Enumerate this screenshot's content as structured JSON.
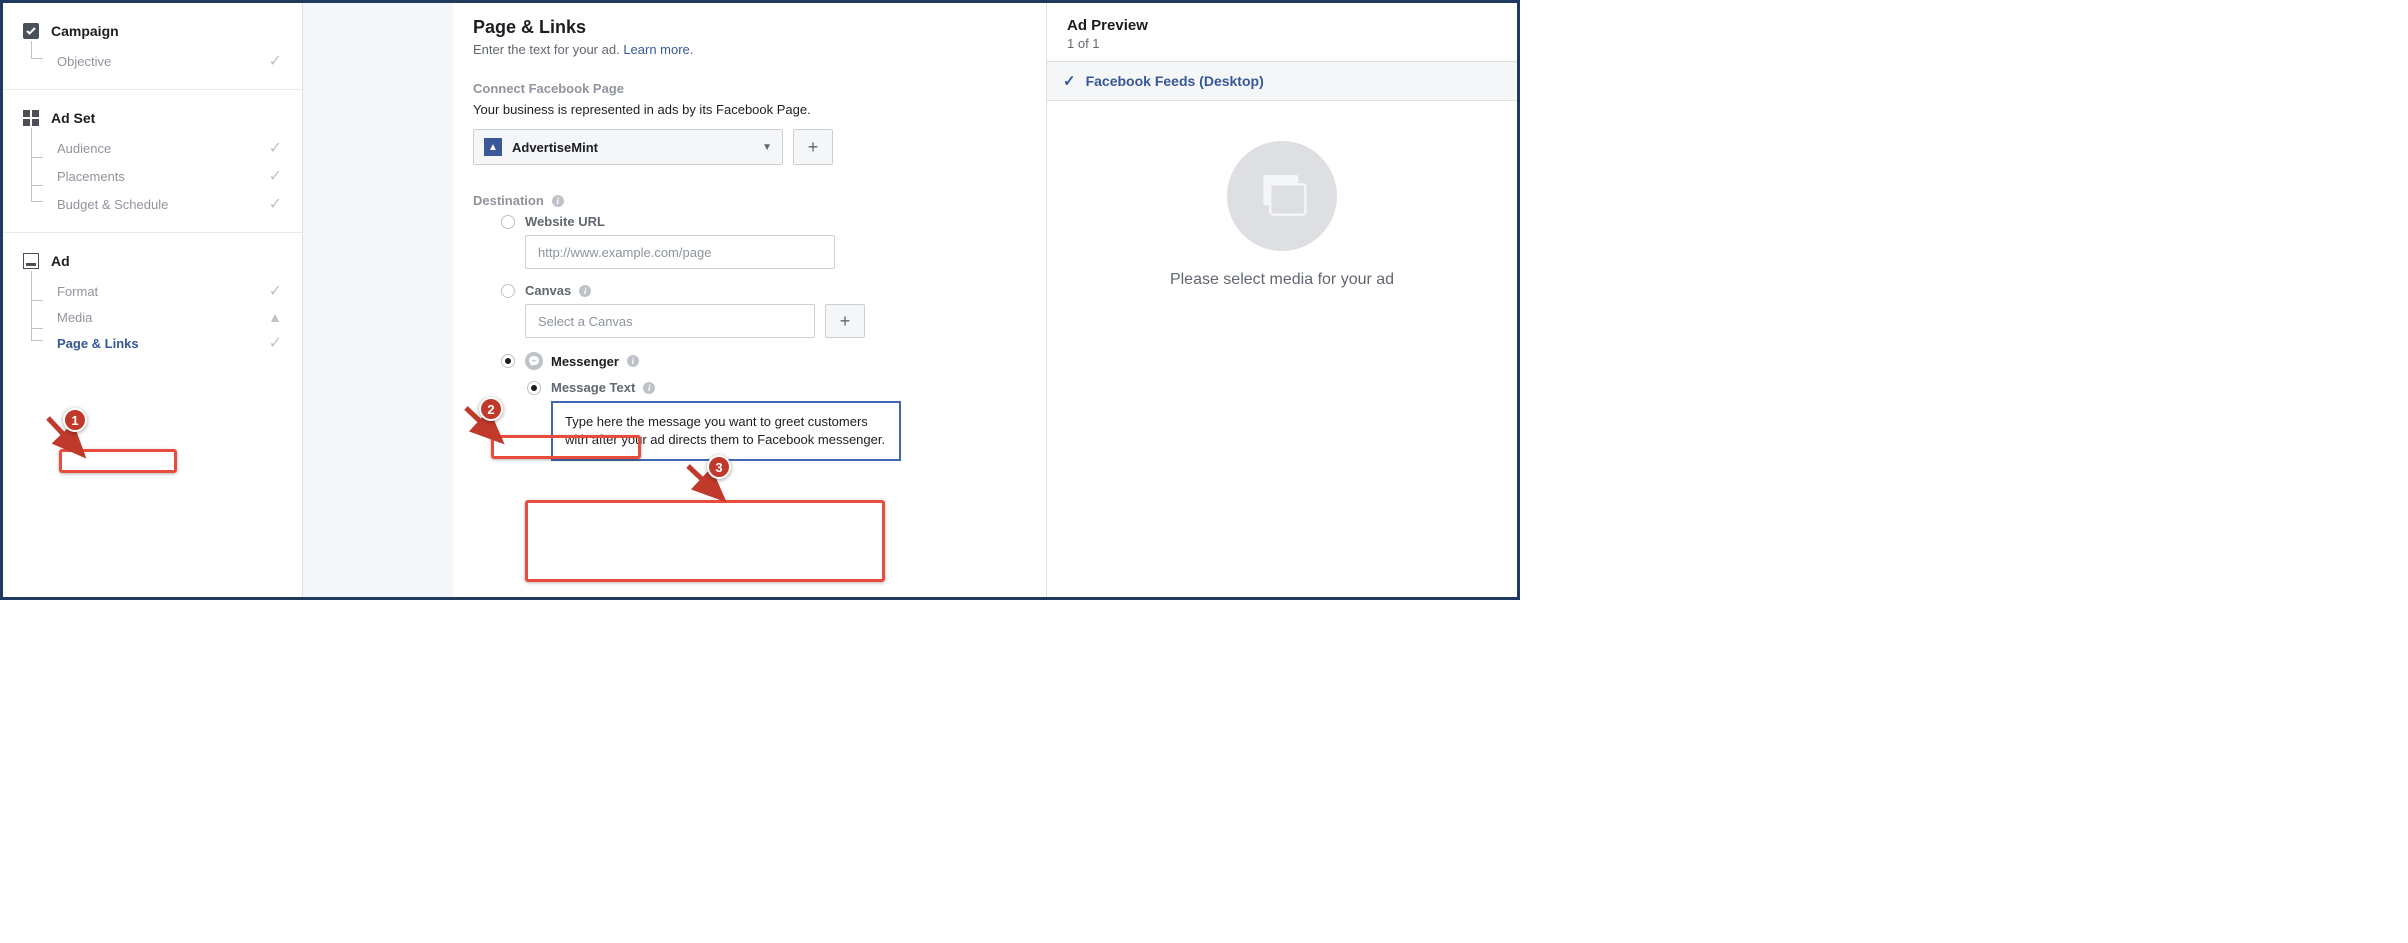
{
  "sidebar": {
    "campaign": {
      "title": "Campaign",
      "items": [
        {
          "label": "Objective",
          "status": "check"
        }
      ]
    },
    "adset": {
      "title": "Ad Set",
      "items": [
        {
          "label": "Audience",
          "status": "check"
        },
        {
          "label": "Placements",
          "status": "check"
        },
        {
          "label": "Budget & Schedule",
          "status": "check"
        }
      ]
    },
    "ad": {
      "title": "Ad",
      "items": [
        {
          "label": "Format",
          "status": "check"
        },
        {
          "label": "Media",
          "status": "warn"
        },
        {
          "label": "Page & Links",
          "status": "check",
          "active": true
        }
      ]
    }
  },
  "main": {
    "title": "Page & Links",
    "subtitle_pre": "Enter the text for your ad. ",
    "subtitle_link": "Learn more",
    "connect": {
      "head": "Connect Facebook Page",
      "desc": "Your business is represented in ads by its Facebook Page.",
      "page_name": "AdvertiseMint"
    },
    "destination": {
      "head": "Destination",
      "website_label": "Website URL",
      "website_placeholder": "http://www.example.com/page",
      "canvas_label": "Canvas",
      "canvas_placeholder": "Select a Canvas",
      "messenger_label": "Messenger",
      "msgtext_label": "Message Text",
      "msgtext_value": "Type here the message you want to greet customers with after your ad directs them to Facebook messenger."
    }
  },
  "preview": {
    "title": "Ad Preview",
    "count": "1 of 1",
    "feed_label": "Facebook Feeds (Desktop)",
    "placeholder": "Please select media for your ad"
  },
  "annotations": {
    "b1": "1",
    "b2": "2",
    "b3": "3"
  }
}
